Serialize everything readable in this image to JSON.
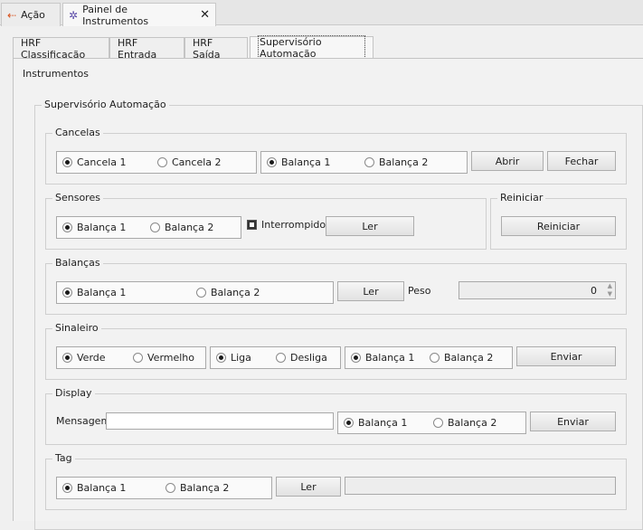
{
  "doc_tabs": [
    {
      "label": "Ação",
      "icon": "back-arrow-icon"
    },
    {
      "label": "Painel de Instrumentos",
      "icon": "gears-icon"
    }
  ],
  "inner_tabs": [
    "HRF Classificação",
    "HRF Entrada",
    "HRF Saída",
    "Supervisório Automação"
  ],
  "section_title": "Instrumentos",
  "outer_group": "Supervisório Automação",
  "cancelas": {
    "title": "Cancelas",
    "opt1": "Cancela 1",
    "opt2": "Cancela 2",
    "bal1": "Balança 1",
    "bal2": "Balança 2",
    "open_btn": "Abrir",
    "close_btn": "Fechar"
  },
  "sensores": {
    "title": "Sensores",
    "bal1": "Balança 1",
    "bal2": "Balança 2",
    "check_label": "Interrompido",
    "read_btn": "Ler"
  },
  "reiniciar": {
    "title": "Reiniciar",
    "btn": "Reiniciar"
  },
  "balancas": {
    "title": "Balanças",
    "bal1": "Balança 1",
    "bal2": "Balança 2",
    "read_btn": "Ler",
    "peso_label": "Peso",
    "peso_value": "0"
  },
  "sinaleiro": {
    "title": "Sinaleiro",
    "verde": "Verde",
    "vermelho": "Vermelho",
    "liga": "Liga",
    "desliga": "Desliga",
    "bal1": "Balança 1",
    "bal2": "Balança 2",
    "send_btn": "Enviar"
  },
  "display": {
    "title": "Display",
    "msg_label": "Mensagem",
    "msg_value": "",
    "bal1": "Balança 1",
    "bal2": "Balança 2",
    "send_btn": "Enviar"
  },
  "tag": {
    "title": "Tag",
    "bal1": "Balança 1",
    "bal2": "Balança 2",
    "read_btn": "Ler",
    "value": ""
  }
}
